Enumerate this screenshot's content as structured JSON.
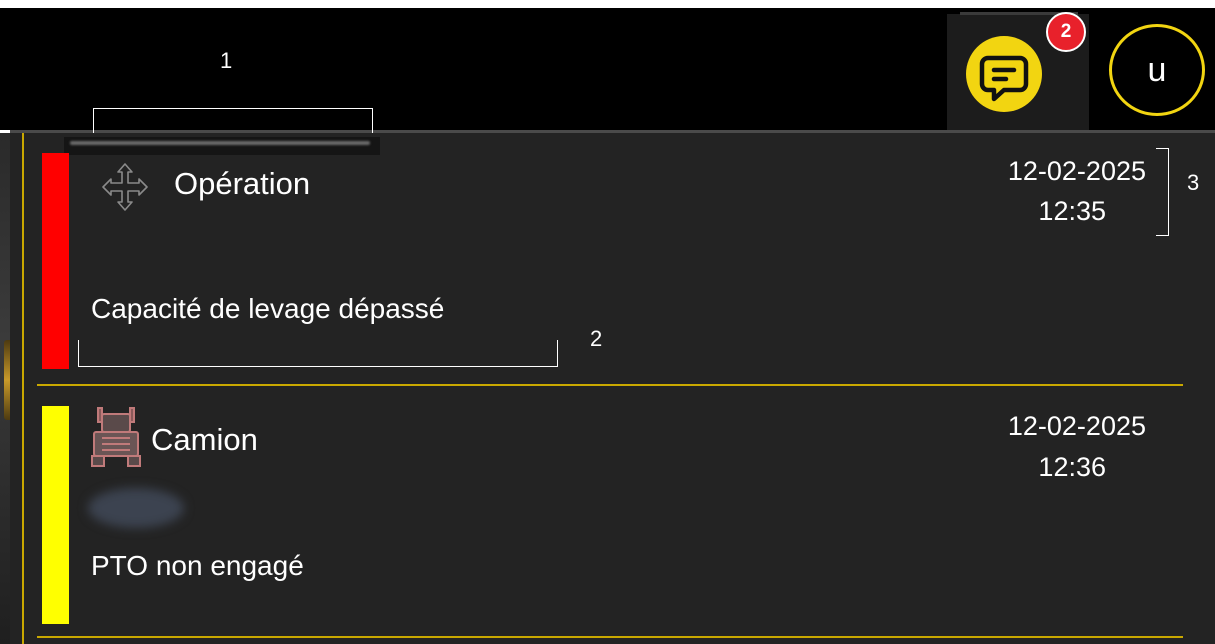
{
  "annotations": {
    "callout_1": "1",
    "callout_2": "2",
    "callout_3": "3"
  },
  "header": {
    "messages_badge_count": "2",
    "user_initial": "u",
    "messages_icon": "chat-bubble-icon"
  },
  "alerts": [
    {
      "category": "Opération",
      "category_icon": "move-arrows-icon",
      "date": "12-02-2025",
      "time": "12:35",
      "message": "Capacité de levage dépassé",
      "severity_color": "#ff0000"
    },
    {
      "category": "Camion",
      "category_icon": "truck-icon",
      "date": "12-02-2025",
      "time": "12:36",
      "message": "PTO non engagé",
      "severity_color": "#ffff00"
    }
  ],
  "colors": {
    "accent_yellow": "#f2d511",
    "badge_red": "#e8212b",
    "panel_background": "#232323",
    "divider_gold": "#c9a800"
  }
}
